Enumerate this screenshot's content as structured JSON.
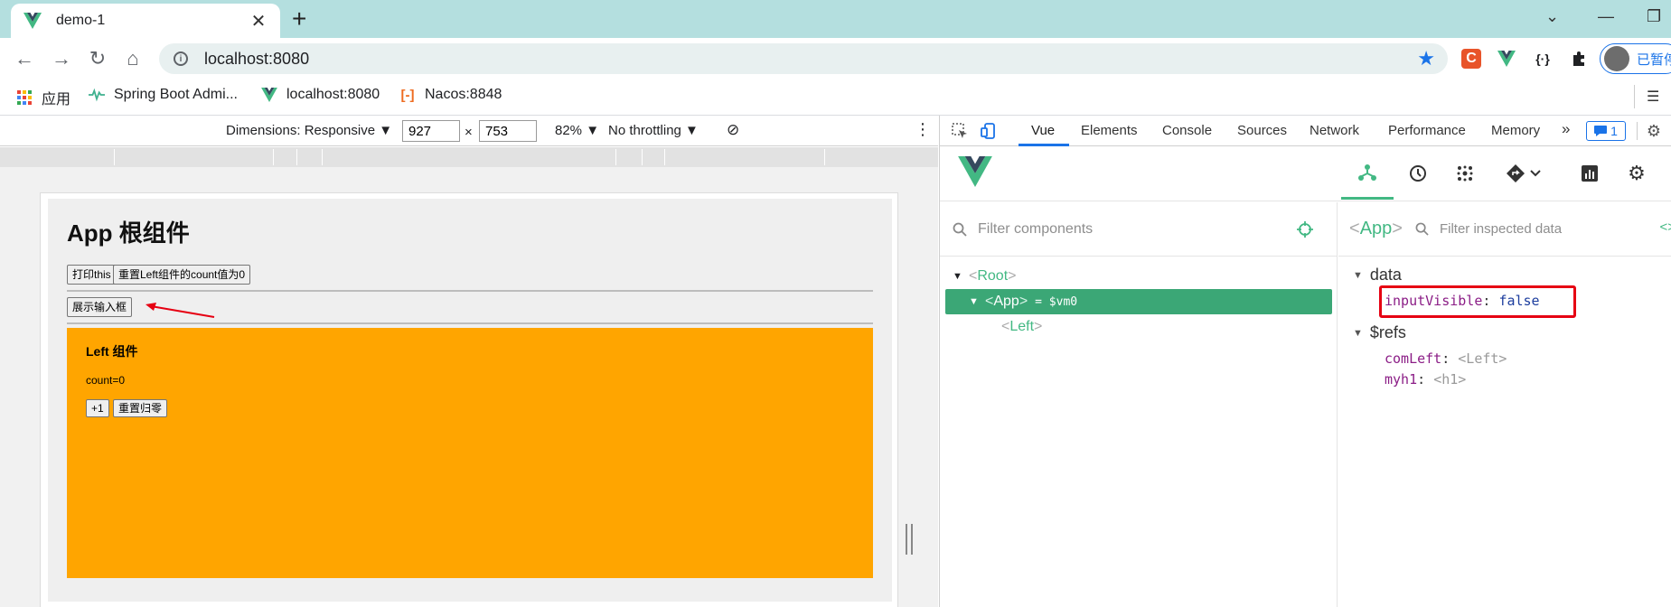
{
  "browser": {
    "tab_title": "demo-1",
    "tab_close": "✕",
    "new_tab": "+",
    "url": "localhost:8080",
    "profile_label": "已暂停",
    "colors": {
      "tabstrip": "#b4dfdf",
      "vue_green": "#42b883",
      "accent_blue": "#1a73e8"
    }
  },
  "bookmarks": [
    {
      "label": "应用",
      "icon": "apps-grid-icon"
    },
    {
      "label": "Spring Boot Admi...",
      "icon": "spring-boot-admin-icon"
    },
    {
      "label": "localhost:8080",
      "icon": "vue-logo-icon"
    },
    {
      "label": "Nacos:8848",
      "icon": "nacos-icon"
    }
  ],
  "device_toolbar": {
    "dimensions_label": "Dimensions: Responsive ▼",
    "width": "927",
    "height": "753",
    "times": "×",
    "zoom": "82% ▼",
    "throttling": "No throttling ▼"
  },
  "app_page": {
    "title": "App 根组件",
    "btn_print_this": "打印this",
    "btn_reset_left": "重置Left组件的count值为0",
    "btn_show_input": "展示输入框",
    "left_title": "Left 组件",
    "count_text": "count=0",
    "btn_plus_one": "+1",
    "btn_reset": "重置归零",
    "left_bg_color": "#ffa500"
  },
  "devtools": {
    "tabs": [
      "Vue",
      "Elements",
      "Console",
      "Sources",
      "Network",
      "Performance",
      "Memory"
    ],
    "more": "»",
    "issues_count": "1"
  },
  "vue_devtools": {
    "filter_components_placeholder": "Filter components",
    "filter_inspected_placeholder": "Filter inspected data",
    "tree": {
      "root": "Root",
      "app": "App",
      "app_suffix": "= $vm0",
      "left": "Left"
    },
    "inspected_component": "App",
    "sections": {
      "data_label": "data",
      "refs_label": "$refs"
    },
    "data_props": [
      {
        "key": "inputVisible",
        "value": "false"
      }
    ],
    "refs_props": [
      {
        "key": "comLeft",
        "value": "<Left>"
      },
      {
        "key": "myh1",
        "value": "<h1>"
      }
    ]
  }
}
